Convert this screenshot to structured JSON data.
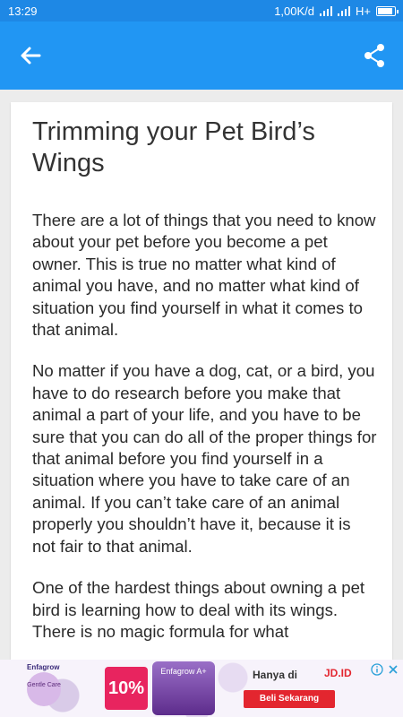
{
  "status_bar": {
    "time": "13:29",
    "speed": "1,00K/d",
    "network_type": "H+",
    "battery_level": 0.95
  },
  "toolbar": {
    "back_icon": "arrow-left-icon",
    "share_icon": "share-icon"
  },
  "article": {
    "title": "Trimming your Pet Bird’s Wings",
    "paragraphs": [
      "There are a lot of things that you need to know about your pet before you become a pet owner. This is true no matter what kind of animal you have, and no matter what kind of situation you find yourself in what it comes to that animal.",
      "No matter if you have a dog, cat, or a bird, you have to do research before you make that animal a part of your life, and you have to be sure that you can do all of the proper things for that animal before you find yourself in a situation where you have to take care of an animal. If you can’t take care of an animal properly you shouldn’t have it, because it is not fair to that animal.",
      "One of the hardest things about owning a pet bird is learning how to deal with its wings. There is no magic formula for what"
    ]
  },
  "ad": {
    "brand": "Enfagrow",
    "badge_text": "Gentle Care",
    "promo": "10%",
    "product": "Enfagrow A+",
    "hanya_di": "Hanya di",
    "store": "JD.ID",
    "cta": "Beli Sekarang"
  },
  "colors": {
    "status_bar": "#1e88e5",
    "toolbar": "#2196f3",
    "cta": "#e3262f"
  }
}
